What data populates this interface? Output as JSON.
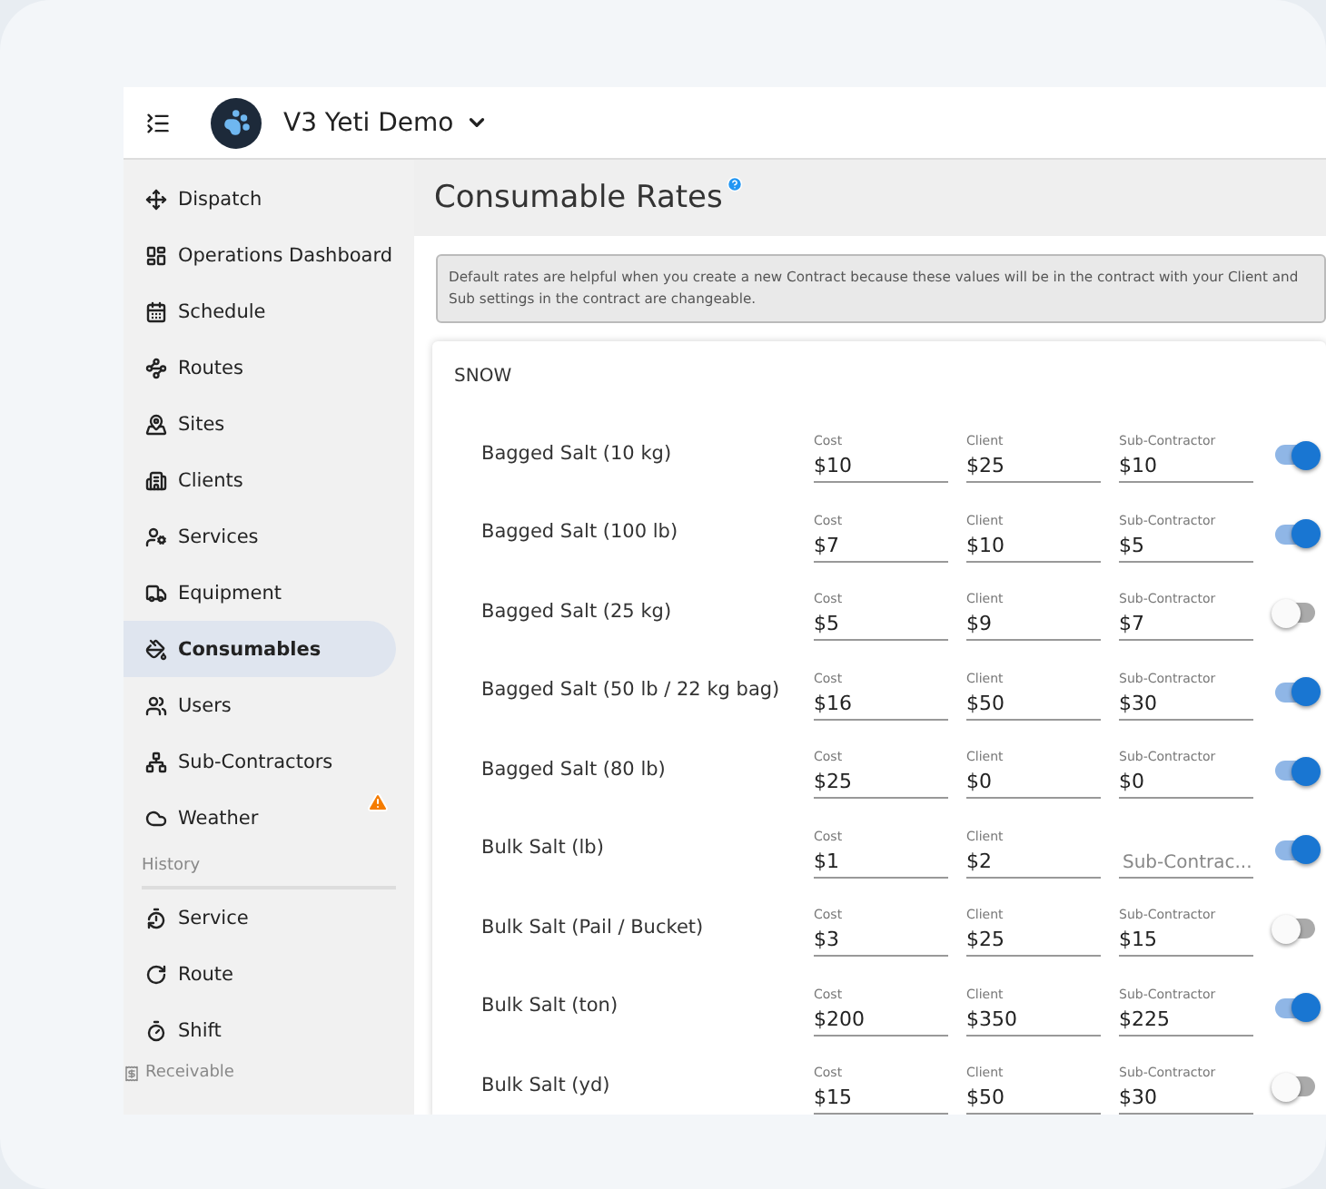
{
  "header": {
    "org_name": "V3 Yeti Demo"
  },
  "sidebar": {
    "sections": [
      {
        "items": [
          {
            "label": "Dispatch",
            "selected": false,
            "alert": false
          },
          {
            "label": "Operations Dashboard",
            "selected": false,
            "alert": false
          },
          {
            "label": "Schedule",
            "selected": false,
            "alert": false
          },
          {
            "label": "Routes",
            "selected": false,
            "alert": false
          },
          {
            "label": "Sites",
            "selected": false,
            "alert": false
          },
          {
            "label": "Clients",
            "selected": false,
            "alert": false
          },
          {
            "label": "Services",
            "selected": false,
            "alert": false
          },
          {
            "label": "Equipment",
            "selected": false,
            "alert": false
          },
          {
            "label": "Consumables",
            "selected": true,
            "alert": false
          },
          {
            "label": "Users",
            "selected": false,
            "alert": false
          },
          {
            "label": "Sub-Contractors",
            "selected": false,
            "alert": false
          },
          {
            "label": "Weather",
            "selected": false,
            "alert": true
          }
        ]
      },
      {
        "title": "History",
        "items": [
          {
            "label": "Service",
            "selected": false,
            "alert": false
          },
          {
            "label": "Route",
            "selected": false,
            "alert": false
          },
          {
            "label": "Shift",
            "selected": false,
            "alert": false
          }
        ]
      },
      {
        "title": "Receivable"
      }
    ]
  },
  "page": {
    "title": "Consumable Rates",
    "info": "Default rates are helpful when you create a new Contract because these values will be in the contract with your Client and Sub settings in the contract are changeable."
  },
  "card": {
    "title": "SNOW",
    "rows": [
      {
        "name": "Bagged Salt (10 kg)",
        "on": true,
        "fields": [
          {
            "label": "Cost",
            "value": "$10"
          },
          {
            "label": "Client",
            "value": "$25"
          },
          {
            "label": "Sub-Contractor",
            "value": "$10"
          }
        ]
      },
      {
        "name": "Bagged Salt (100 lb)",
        "on": true,
        "fields": [
          {
            "label": "Cost",
            "value": "$7"
          },
          {
            "label": "Client",
            "value": "$10"
          },
          {
            "label": "Sub-Contractor",
            "value": "$5"
          }
        ]
      },
      {
        "name": "Bagged Salt (25 kg)",
        "on": false,
        "fields": [
          {
            "label": "Cost",
            "value": "$5"
          },
          {
            "label": "Client",
            "value": "$9"
          },
          {
            "label": "Sub-Contractor",
            "value": "$7"
          }
        ]
      },
      {
        "name": "Bagged Salt (50 lb / 22 kg bag)",
        "on": true,
        "fields": [
          {
            "label": "Cost",
            "value": "$16"
          },
          {
            "label": "Client",
            "value": "$50"
          },
          {
            "label": "Sub-Contractor",
            "value": "$30"
          }
        ]
      },
      {
        "name": "Bagged Salt (80 lb)",
        "on": true,
        "fields": [
          {
            "label": "Cost",
            "value": "$25"
          },
          {
            "label": "Client",
            "value": "$0"
          },
          {
            "label": "Sub-Contractor",
            "value": "$0"
          }
        ]
      },
      {
        "name": "Bulk Salt (lb)",
        "on": true,
        "fields": [
          {
            "label": "Cost",
            "value": "$1"
          },
          {
            "label": "Client",
            "value": "$2"
          },
          {
            "placeholder": "Sub-Contrac..."
          }
        ]
      },
      {
        "name": "Bulk Salt (Pail / Bucket)",
        "on": false,
        "fields": [
          {
            "label": "Cost",
            "value": "$3"
          },
          {
            "label": "Client",
            "value": "$25"
          },
          {
            "label": "Sub-Contractor",
            "value": "$15"
          }
        ]
      },
      {
        "name": "Bulk Salt (ton)",
        "on": true,
        "fields": [
          {
            "label": "Cost",
            "value": "$200"
          },
          {
            "label": "Client",
            "value": "$350"
          },
          {
            "label": "Sub-Contractor",
            "value": "$225"
          }
        ]
      },
      {
        "name": "Bulk Salt (yd)",
        "on": false,
        "fields": [
          {
            "label": "Cost",
            "value": "$15"
          },
          {
            "label": "Client",
            "value": "$50"
          },
          {
            "label": "Sub-Contractor",
            "value": "$30"
          }
        ]
      }
    ]
  }
}
